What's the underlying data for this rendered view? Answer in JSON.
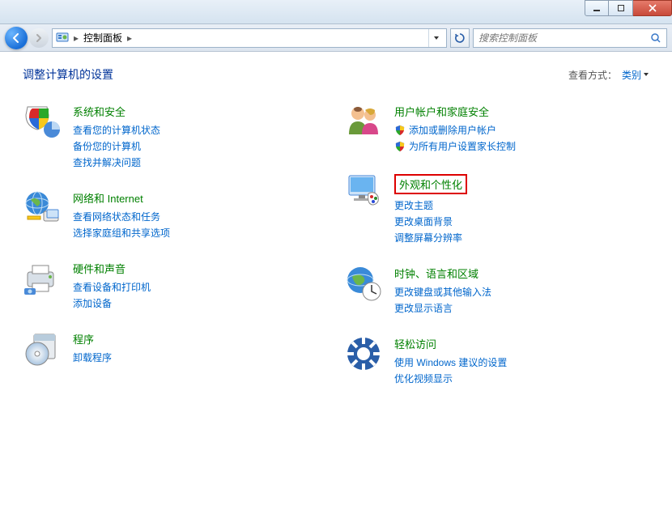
{
  "titlebar": {},
  "navbar": {
    "breadcrumb_root": "控制面板",
    "search_placeholder": "搜索控制面板"
  },
  "header": {
    "title": "调整计算机的设置",
    "view_label": "查看方式：",
    "view_value": "类别"
  },
  "categories": {
    "left": [
      {
        "id": "system-security",
        "title": "系统和安全",
        "links": [
          {
            "text": "查看您的计算机状态",
            "shield": false
          },
          {
            "text": "备份您的计算机",
            "shield": false
          },
          {
            "text": "查找并解决问题",
            "shield": false
          }
        ]
      },
      {
        "id": "network-internet",
        "title": "网络和 Internet",
        "links": [
          {
            "text": "查看网络状态和任务",
            "shield": false
          },
          {
            "text": "选择家庭组和共享选项",
            "shield": false
          }
        ]
      },
      {
        "id": "hardware-sound",
        "title": "硬件和声音",
        "links": [
          {
            "text": "查看设备和打印机",
            "shield": false
          },
          {
            "text": "添加设备",
            "shield": false
          }
        ]
      },
      {
        "id": "programs",
        "title": "程序",
        "links": [
          {
            "text": "卸载程序",
            "shield": false
          }
        ]
      }
    ],
    "right": [
      {
        "id": "user-accounts",
        "title": "用户帐户和家庭安全",
        "links": [
          {
            "text": "添加或删除用户帐户",
            "shield": true
          },
          {
            "text": "为所有用户设置家长控制",
            "shield": true
          }
        ]
      },
      {
        "id": "appearance",
        "title": "外观和个性化",
        "highlighted": true,
        "links": [
          {
            "text": "更改主题",
            "shield": false
          },
          {
            "text": "更改桌面背景",
            "shield": false
          },
          {
            "text": "调整屏幕分辨率",
            "shield": false
          }
        ]
      },
      {
        "id": "clock-language",
        "title": "时钟、语言和区域",
        "links": [
          {
            "text": "更改键盘或其他输入法",
            "shield": false
          },
          {
            "text": "更改显示语言",
            "shield": false
          }
        ]
      },
      {
        "id": "ease-of-access",
        "title": "轻松访问",
        "links": [
          {
            "text": "使用 Windows 建议的设置",
            "shield": false
          },
          {
            "text": "优化视频显示",
            "shield": false
          }
        ]
      }
    ]
  },
  "icons": {
    "system-security": "shield-pie",
    "network-internet": "globe-network",
    "hardware-sound": "printer-device",
    "programs": "cd-box",
    "user-accounts": "people",
    "appearance": "monitor-paint",
    "clock-language": "globe-clock",
    "ease-of-access": "ease-access"
  }
}
